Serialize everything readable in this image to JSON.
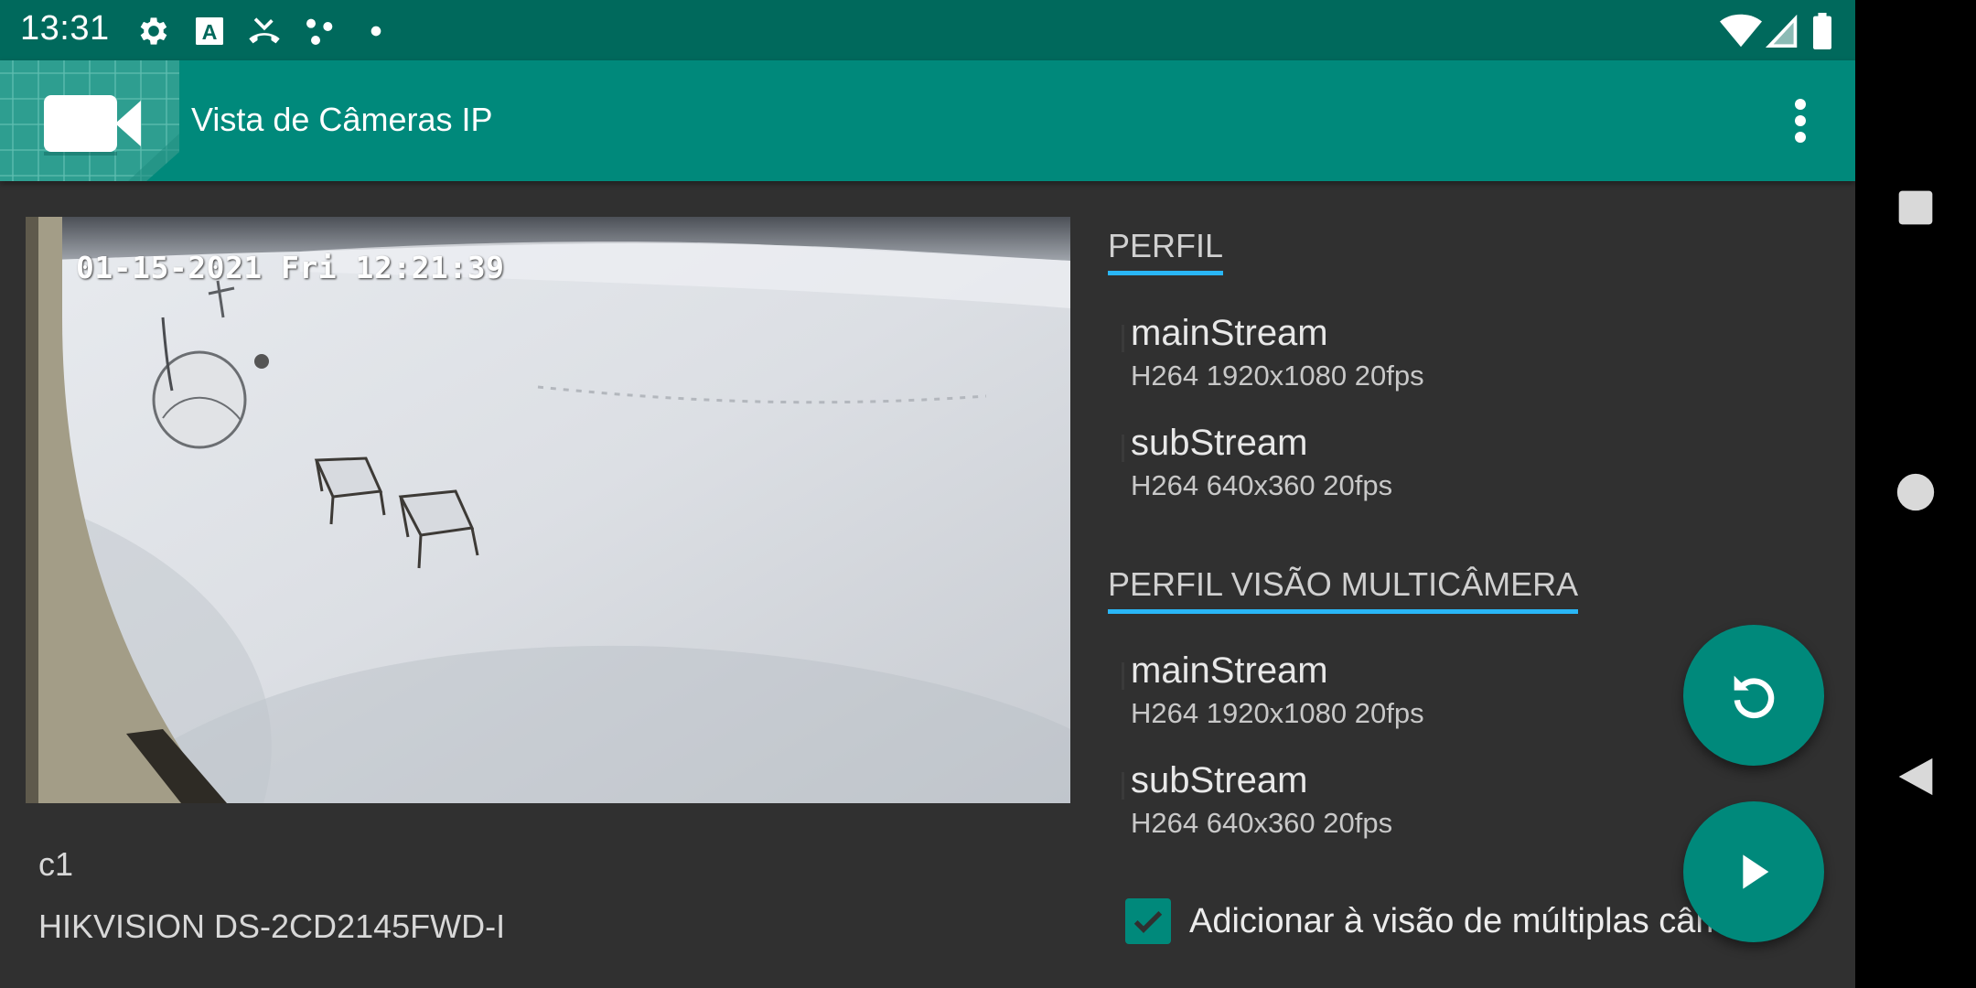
{
  "status_bar": {
    "time": "13:31",
    "icons": [
      "settings-icon",
      "a-box-icon",
      "missed-call-icon",
      "dots-icon",
      "dot-icon"
    ],
    "right_icons": [
      "wifi-icon",
      "signal-icon",
      "battery-icon"
    ]
  },
  "app_bar": {
    "title": "Vista de Câmeras IP",
    "logo_icon": "video-camera-icon",
    "menu_icon": "more-vert-icon"
  },
  "camera": {
    "timestamp": "01-15-2021 Fri 12:21:39",
    "name": "c1",
    "model": "HIKVISION DS-2CD2145FWD-I"
  },
  "profile": {
    "header": "PERFIL",
    "streams": [
      {
        "name": "mainStream",
        "detail": "H264 1920x1080 20fps"
      },
      {
        "name": "subStream",
        "detail": "H264 640x360 20fps"
      }
    ]
  },
  "multi_profile": {
    "header": "PERFIL VISÃO MULTICÂMERA",
    "streams": [
      {
        "name": "mainStream",
        "detail": "H264 1920x1080 20fps"
      },
      {
        "name": "subStream",
        "detail": "H264 640x360 20fps"
      }
    ]
  },
  "checkbox": {
    "label": "Adicionar à visão de múltiplas câmeras",
    "checked": true
  },
  "fabs": {
    "refresh_icon": "refresh-icon",
    "play_icon": "play-icon"
  },
  "nav": {
    "recents_icon": "square-icon",
    "home_icon": "circle-icon",
    "back_icon": "back-triangle-icon"
  },
  "colors": {
    "status_bar": "#00695c",
    "app_bar": "#00897b",
    "accent": "#29b6f6",
    "background": "#303030"
  }
}
